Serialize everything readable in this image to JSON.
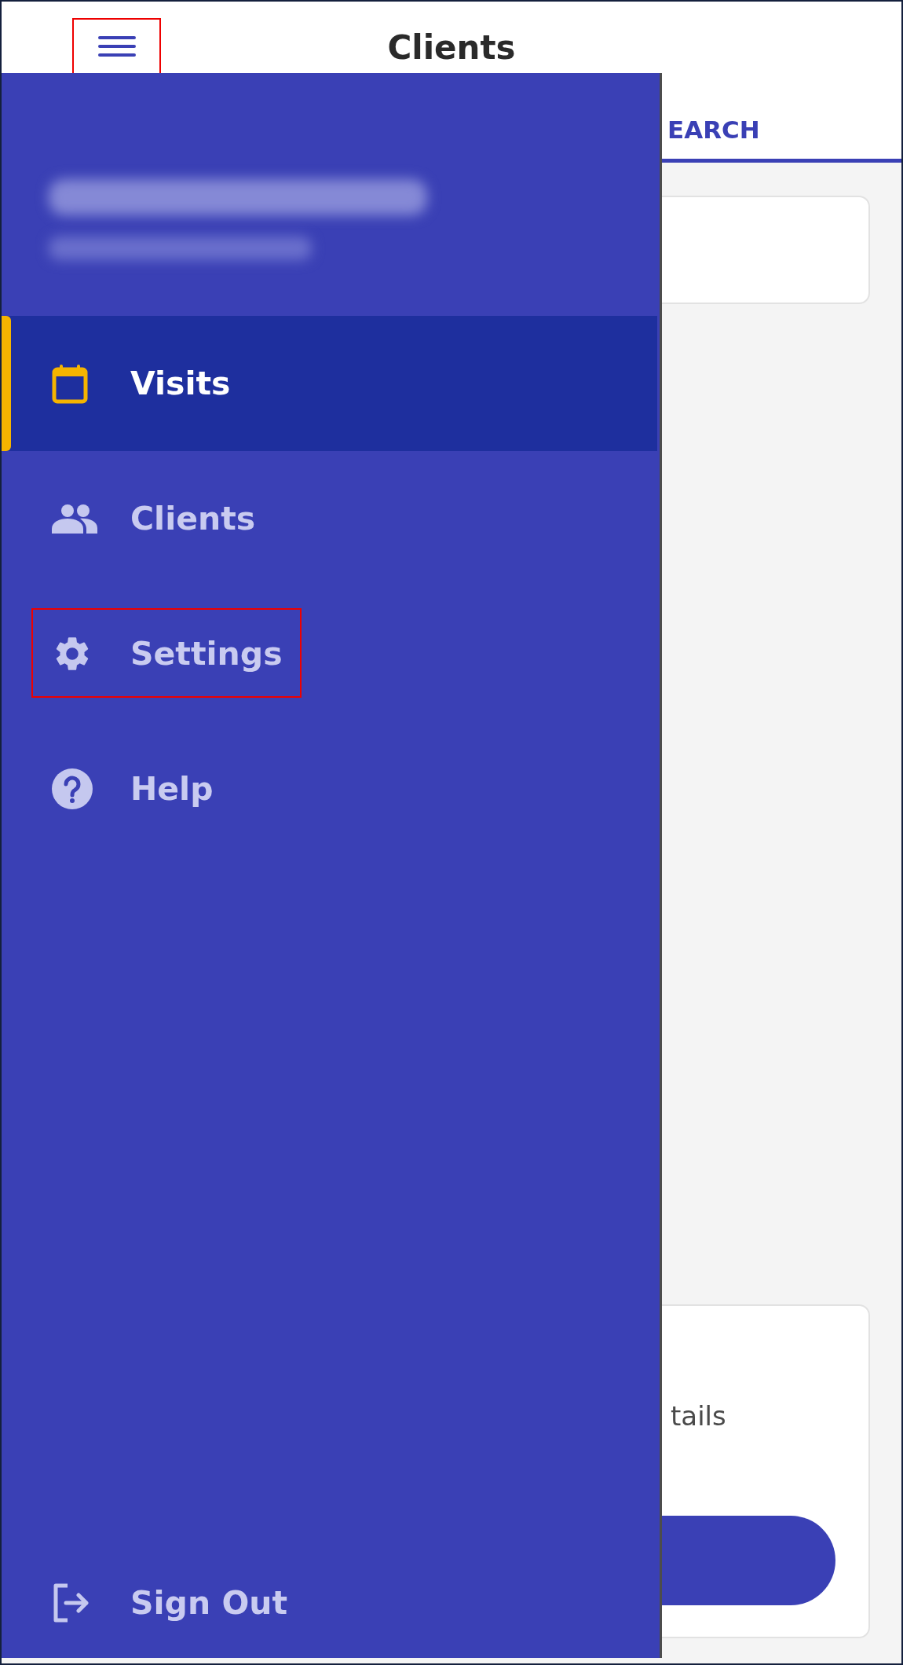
{
  "header": {
    "menu_button": {
      "highlighted": true
    },
    "title": "Clients"
  },
  "tabs": [
    {
      "label": "EARCH",
      "selected": true
    }
  ],
  "cards": [
    {
      "kind": "field"
    },
    {
      "kind": "details",
      "text": "tails",
      "has_button": true
    }
  ],
  "drawer": {
    "items": [
      {
        "label": "Visits",
        "selected": true,
        "highlighted": false
      },
      {
        "label": "Clients",
        "selected": false,
        "highlighted": false
      },
      {
        "label": "Settings",
        "selected": false,
        "highlighted": true
      },
      {
        "label": "Help",
        "selected": false,
        "highlighted": false
      }
    ],
    "sign_out": {
      "label": "Sign Out"
    }
  }
}
